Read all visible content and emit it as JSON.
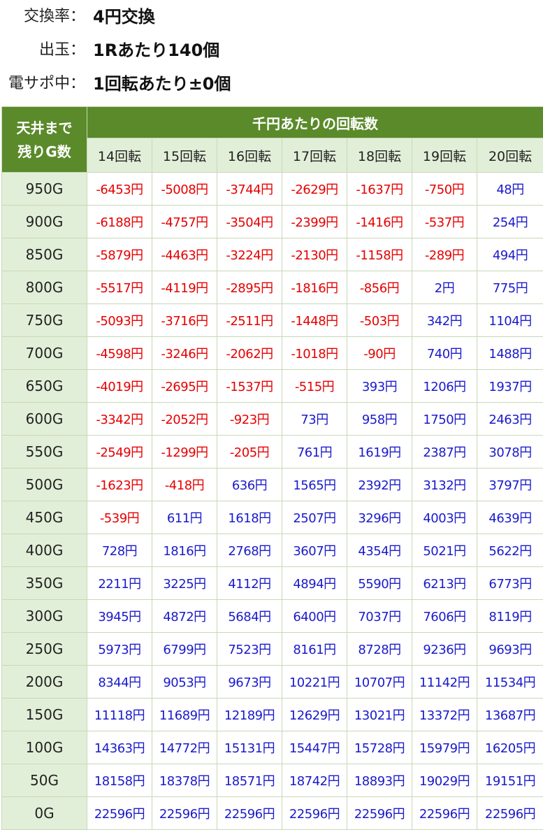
{
  "info": [
    {
      "label": "交換率：",
      "value": "4円交換"
    },
    {
      "label": "出玉：",
      "value": "1Rあたり140個"
    },
    {
      "label": "電サポ中：",
      "value": "1回転あたり±0個"
    }
  ],
  "table": {
    "corner_line1": "天井まで",
    "corner_line2": "残りG数",
    "group_header": "千円あたりの回転数",
    "columns": [
      "14回転",
      "15回転",
      "16回転",
      "17回転",
      "18回転",
      "19回転",
      "20回転"
    ],
    "rows": [
      {
        "label": "950G",
        "cells": [
          "-6453円",
          "-5008円",
          "-3744円",
          "-2629円",
          "-1637円",
          "-750円",
          "48円"
        ]
      },
      {
        "label": "900G",
        "cells": [
          "-6188円",
          "-4757円",
          "-3504円",
          "-2399円",
          "-1416円",
          "-537円",
          "254円"
        ]
      },
      {
        "label": "850G",
        "cells": [
          "-5879円",
          "-4463円",
          "-3224円",
          "-2130円",
          "-1158円",
          "-289円",
          "494円"
        ]
      },
      {
        "label": "800G",
        "cells": [
          "-5517円",
          "-4119円",
          "-2895円",
          "-1816円",
          "-856円",
          "2円",
          "775円"
        ]
      },
      {
        "label": "750G",
        "cells": [
          "-5093円",
          "-3716円",
          "-2511円",
          "-1448円",
          "-503円",
          "342円",
          "1104円"
        ]
      },
      {
        "label": "700G",
        "cells": [
          "-4598円",
          "-3246円",
          "-2062円",
          "-1018円",
          "-90円",
          "740円",
          "1488円"
        ]
      },
      {
        "label": "650G",
        "cells": [
          "-4019円",
          "-2695円",
          "-1537円",
          "-515円",
          "393円",
          "1206円",
          "1937円"
        ]
      },
      {
        "label": "600G",
        "cells": [
          "-3342円",
          "-2052円",
          "-923円",
          "73円",
          "958円",
          "1750円",
          "2463円"
        ]
      },
      {
        "label": "550G",
        "cells": [
          "-2549円",
          "-1299円",
          "-205円",
          "761円",
          "1619円",
          "2387円",
          "3078円"
        ]
      },
      {
        "label": "500G",
        "cells": [
          "-1623円",
          "-418円",
          "636円",
          "1565円",
          "2392円",
          "3132円",
          "3797円"
        ]
      },
      {
        "label": "450G",
        "cells": [
          "-539円",
          "611円",
          "1618円",
          "2507円",
          "3296円",
          "4003円",
          "4639円"
        ]
      },
      {
        "label": "400G",
        "cells": [
          "728円",
          "1816円",
          "2768円",
          "3607円",
          "4354円",
          "5021円",
          "5622円"
        ]
      },
      {
        "label": "350G",
        "cells": [
          "2211円",
          "3225円",
          "4112円",
          "4894円",
          "5590円",
          "6213円",
          "6773円"
        ]
      },
      {
        "label": "300G",
        "cells": [
          "3945円",
          "4872円",
          "5684円",
          "6400円",
          "7037円",
          "7606円",
          "8119円"
        ]
      },
      {
        "label": "250G",
        "cells": [
          "5973円",
          "6799円",
          "7523円",
          "8161円",
          "8728円",
          "9236円",
          "9693円"
        ]
      },
      {
        "label": "200G",
        "cells": [
          "8344円",
          "9053円",
          "9673円",
          "10221円",
          "10707円",
          "11142円",
          "11534円"
        ]
      },
      {
        "label": "150G",
        "cells": [
          "11118円",
          "11689円",
          "12189円",
          "12629円",
          "13021円",
          "13372円",
          "13687円"
        ]
      },
      {
        "label": "100G",
        "cells": [
          "14363円",
          "14772円",
          "15131円",
          "15447円",
          "15728円",
          "15979円",
          "16205円"
        ]
      },
      {
        "label": "50G",
        "cells": [
          "18158円",
          "18378円",
          "18571円",
          "18742円",
          "18893円",
          "19029円",
          "19151円"
        ]
      },
      {
        "label": "0G",
        "cells": [
          "22596円",
          "22596円",
          "22596円",
          "22596円",
          "22596円",
          "22596円",
          "22596円"
        ]
      }
    ]
  }
}
